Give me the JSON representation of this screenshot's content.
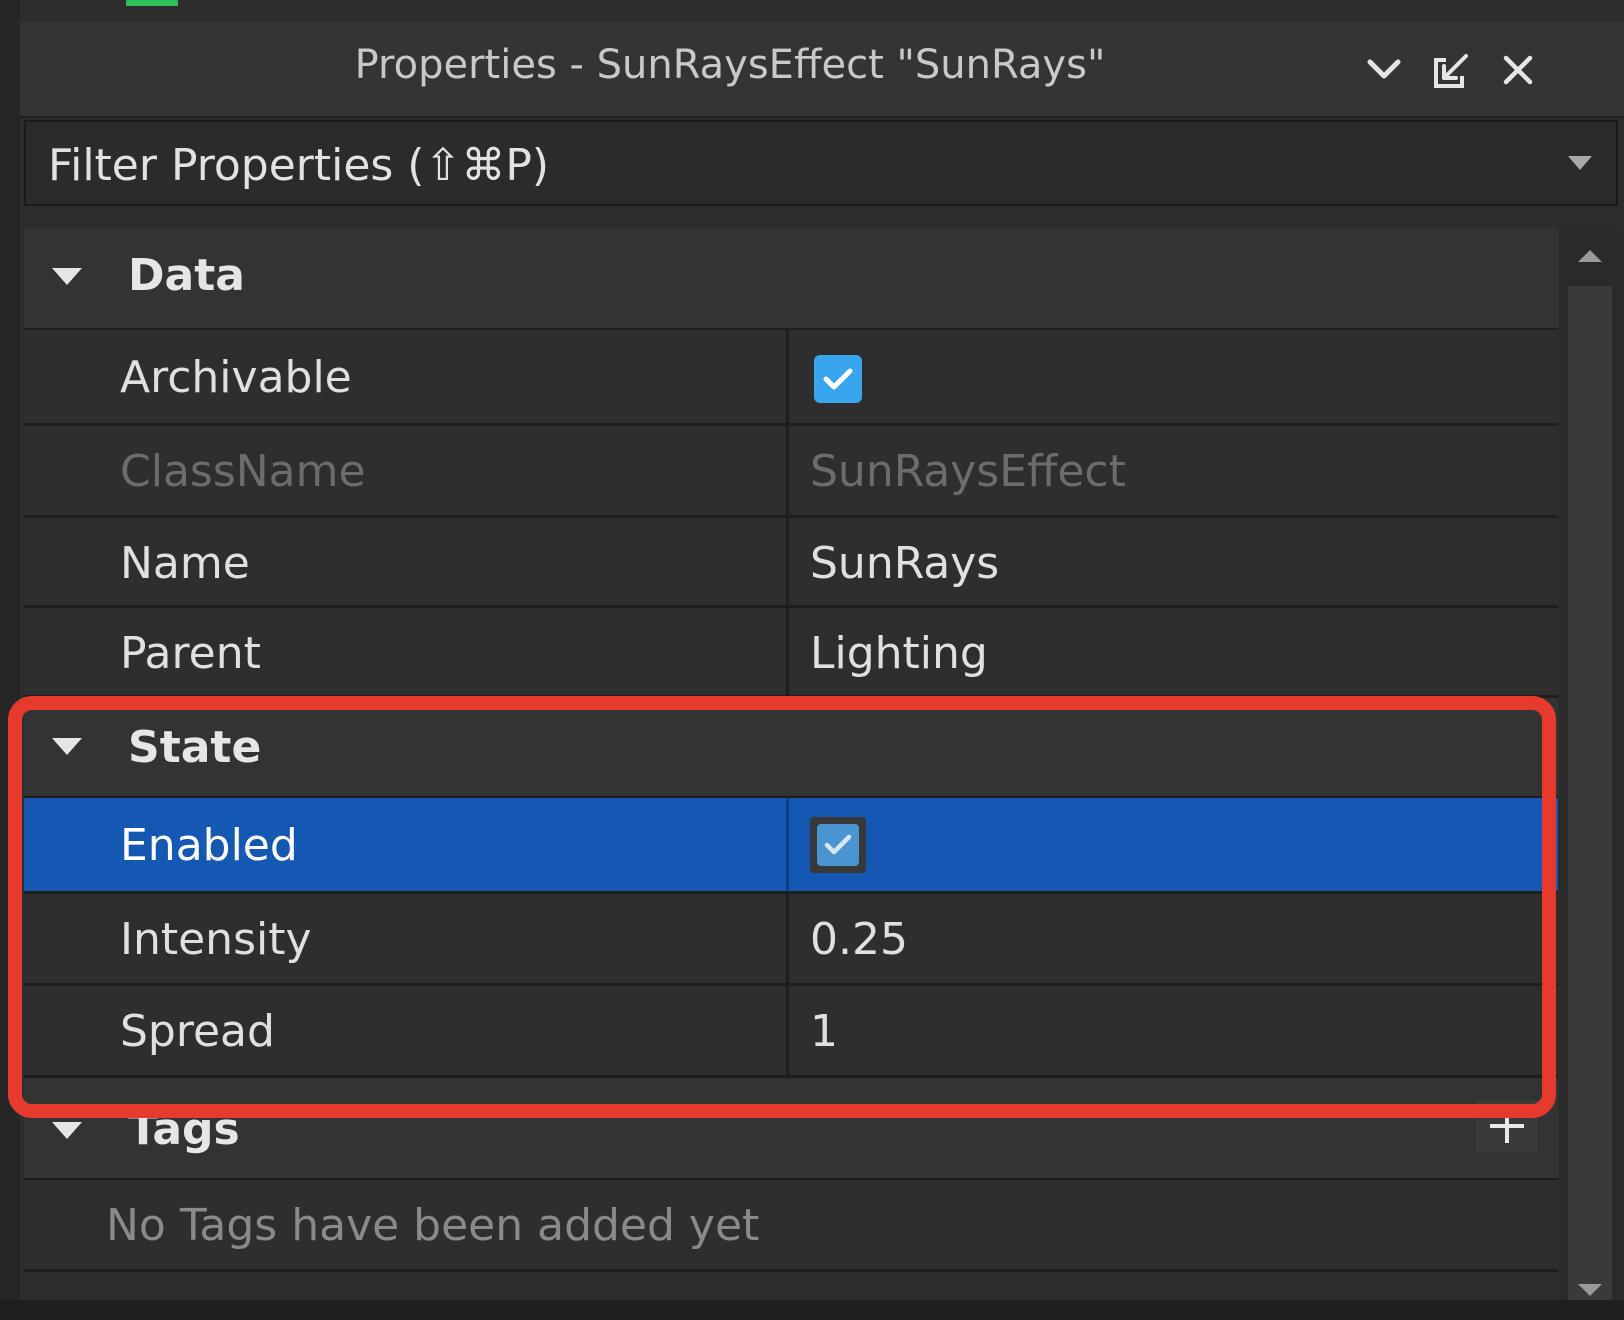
{
  "window": {
    "title": "Properties - SunRaysEffect \"SunRays\""
  },
  "filter": {
    "placeholder": "Filter Properties (⇧⌘P)"
  },
  "sections": {
    "data": {
      "label": "Data",
      "rows": {
        "archivable": {
          "name": "Archivable",
          "checked": true
        },
        "classname": {
          "name": "ClassName",
          "value": "SunRaysEffect"
        },
        "name": {
          "name": "Name",
          "value": "SunRays"
        },
        "parent": {
          "name": "Parent",
          "value": "Lighting"
        }
      }
    },
    "state": {
      "label": "State",
      "rows": {
        "enabled": {
          "name": "Enabled",
          "checked": true
        },
        "intensity": {
          "name": "Intensity",
          "value": "0.25"
        },
        "spread": {
          "name": "Spread",
          "value": "1"
        }
      }
    },
    "tags": {
      "label": "Tags",
      "empty_message": "No Tags have been added yet"
    }
  },
  "colors": {
    "selected_row": "#1458b4",
    "highlight_border": "#e63a2c",
    "checkbox": "#3aa5ef"
  },
  "icons": {
    "collapse": "chevron-down-icon",
    "dock": "dock-icon",
    "close": "close-icon",
    "section_toggle": "triangle-down-icon",
    "add_tag": "plus-icon"
  }
}
